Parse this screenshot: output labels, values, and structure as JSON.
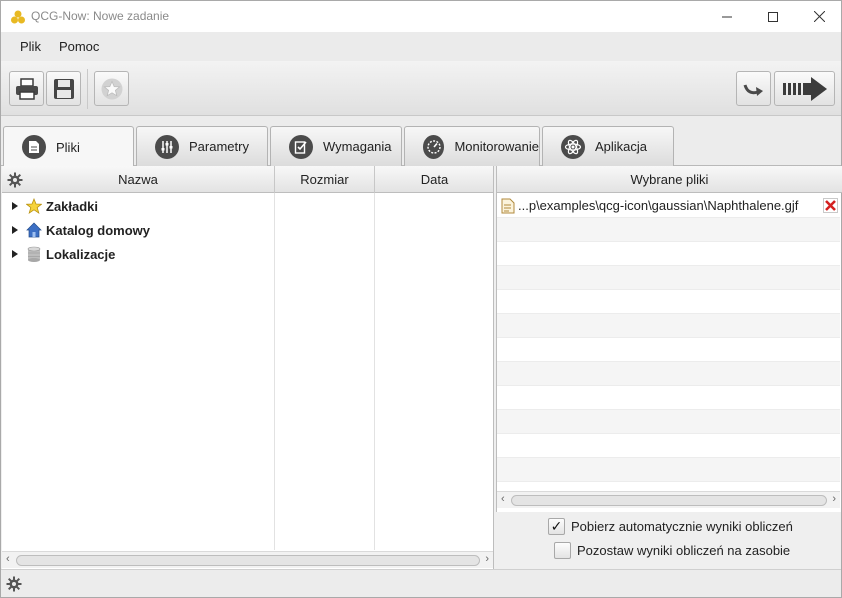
{
  "window": {
    "title": "QCG-Now: Nowe zadanie",
    "minimize": "—",
    "maximize": "☐",
    "close": "✕"
  },
  "menu": {
    "items": [
      {
        "label": "Plik"
      },
      {
        "label": "Pomoc"
      }
    ]
  },
  "toolbar": {
    "buttons": [
      {
        "icon": "print-icon"
      },
      {
        "icon": "save-icon"
      },
      {
        "icon": "star-icon"
      },
      {
        "icon": "undo-arrow-icon"
      },
      {
        "icon": "submit-arrow-icon"
      }
    ]
  },
  "tabs": [
    {
      "label": "Pliki",
      "icon": "document-icon",
      "active": true
    },
    {
      "label": "Parametry",
      "icon": "sliders-icon"
    },
    {
      "label": "Wymagania",
      "icon": "checklist-icon"
    },
    {
      "label": "Monitorowanie",
      "icon": "gauge-icon"
    },
    {
      "label": "Aplikacja",
      "icon": "atom-icon"
    }
  ],
  "file_browser": {
    "columns": [
      "Nazwa",
      "Rozmiar",
      "Data"
    ],
    "items": [
      {
        "label": "Zakładki",
        "icon": "star-icon"
      },
      {
        "label": "Katalog domowy",
        "icon": "home-icon"
      },
      {
        "label": "Lokalizacje",
        "icon": "database-icon"
      }
    ]
  },
  "selected_files": {
    "header": "Wybrane pliki",
    "files": [
      {
        "path": "...p\\examples\\qcg-icon\\gaussian\\Naphthalene.gjf"
      }
    ]
  },
  "options": {
    "auto_fetch": {
      "label": "Pobierz automatycznie wyniki obliczeń",
      "checked": true,
      "mark": "✓"
    },
    "keep_results": {
      "label": "Pozostaw wyniki obliczeń na zasobie",
      "checked": false
    }
  },
  "colors": {
    "accent_gold": "#e8b923",
    "icon_dark": "#4b4b4b",
    "remove_red": "#d42020"
  }
}
